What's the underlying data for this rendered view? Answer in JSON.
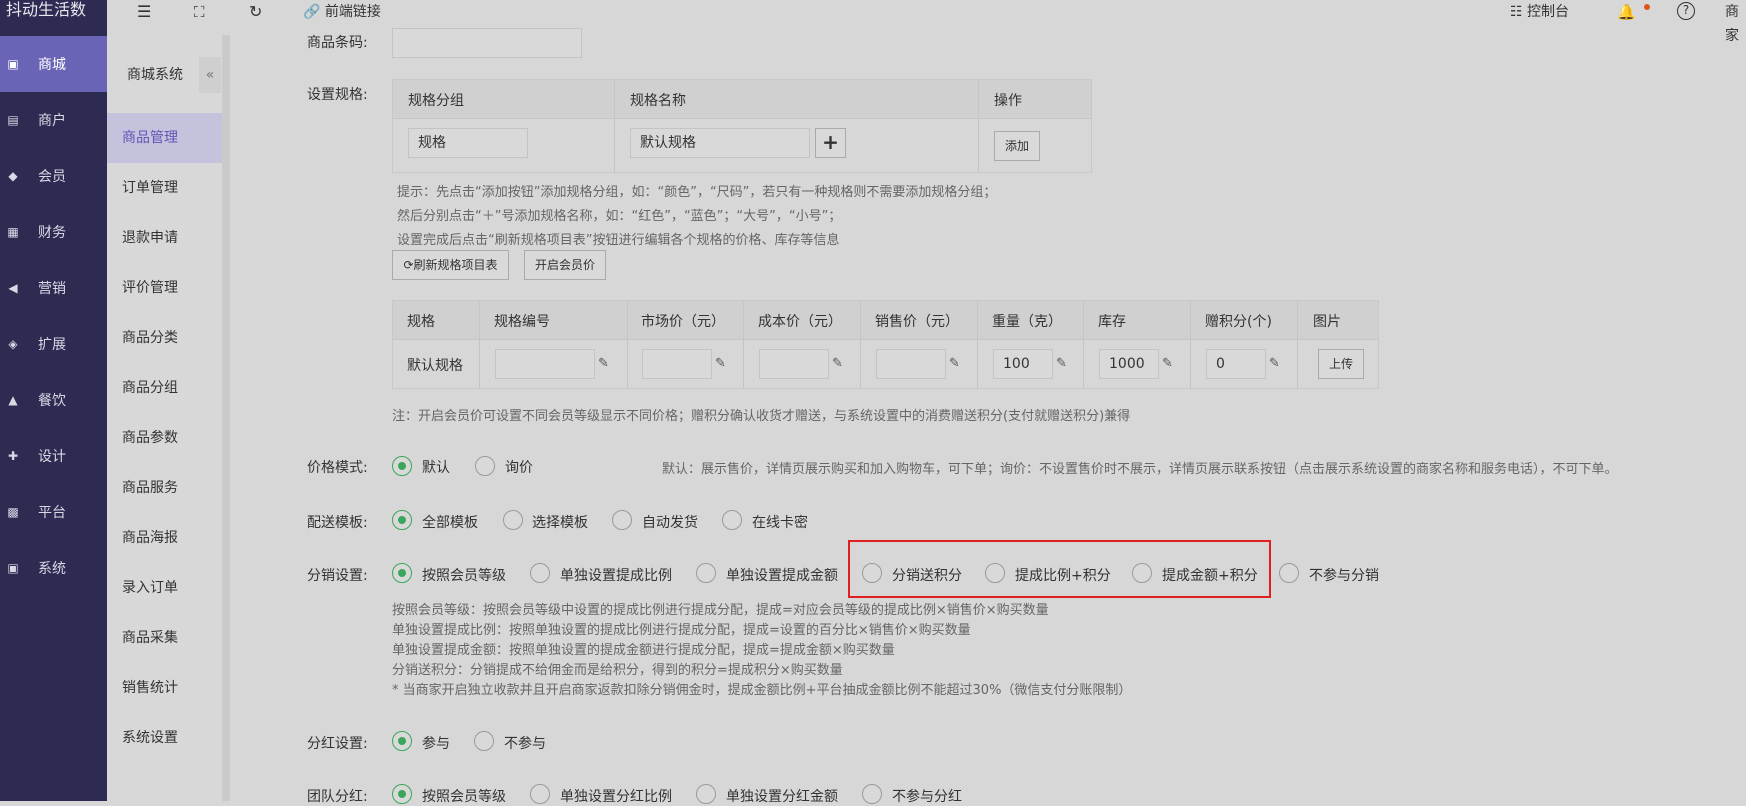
{
  "brand": "抖动生活数",
  "left_nav": [
    {
      "label": "商城",
      "icon": "shop-icon",
      "active": true
    },
    {
      "label": "商户",
      "icon": "merchant-icon",
      "active": false
    },
    {
      "label": "会员",
      "icon": "member-icon",
      "active": false
    },
    {
      "label": "财务",
      "icon": "finance-icon",
      "active": false
    },
    {
      "label": "营销",
      "icon": "marketing-icon",
      "active": false
    },
    {
      "label": "扩展",
      "icon": "extension-icon",
      "active": false
    },
    {
      "label": "餐饮",
      "icon": "dining-icon",
      "active": false
    },
    {
      "label": "设计",
      "icon": "design-icon",
      "active": false
    },
    {
      "label": "平台",
      "icon": "platform-icon",
      "active": false
    },
    {
      "label": "系统",
      "icon": "system-icon",
      "active": false
    }
  ],
  "sub_nav": {
    "title": "商城系统",
    "collapse_icon": "«",
    "items": [
      "商品管理",
      "订单管理",
      "退款申请",
      "评价管理",
      "商品分类",
      "商品分组",
      "商品参数",
      "商品服务",
      "商品海报",
      "录入订单",
      "商品采集",
      "销售统计",
      "系统设置"
    ]
  },
  "header": {
    "frontend_link": "前端链接",
    "console": "控制台",
    "merchant": "商家"
  },
  "form": {
    "barcode_label": "商品条码:",
    "spec_label": "设置规格:",
    "spec_table": {
      "headers": [
        "规格分组",
        "规格名称",
        "操作"
      ],
      "group_value": "规格",
      "name_value": "默认规格",
      "plus": "+",
      "add_button": "添加"
    },
    "spec_hints": [
      "提示：先点击“添加按钮”添加规格分组，如：“颜色”，“尺码”，若只有一种规格则不需要添加规格分组；",
      "然后分别点击“＋”号添加规格名称，如：“红色”，“蓝色”；“大号”，“小号”；",
      "设置完成后点击“刷新规格项目表”按钮进行编辑各个规格的价格、库存等信息"
    ],
    "refresh_button": "刷新规格项目表",
    "member_price_button": "开启会员价",
    "sku_table": {
      "headers": [
        "规格",
        "规格编号",
        "市场价（元）",
        "成本价（元）",
        "销售价（元）",
        "重量（克）",
        "库存",
        "赠积分(个)",
        "图片"
      ],
      "row": {
        "spec": "默认规格",
        "code": "",
        "market": "",
        "cost": "",
        "sale": "",
        "weight": "100",
        "stock": "1000",
        "points": "0",
        "upload": "上传"
      }
    },
    "sku_note": "注：开启会员价可设置不同会员等级显示不同价格；赠积分确认收货才赠送，与系统设置中的消费赠送积分(支付就赠送积分)兼得",
    "price_mode": {
      "label": "价格模式:",
      "options": [
        "默认",
        "询价"
      ],
      "selected": 0,
      "hint": "默认：展示售价，详情页展示购买和加入购物车，可下单；询价：不设置售价时不展示，详情页展示联系按钮（点击展示系统设置的商家名称和服务电话），不可下单。"
    },
    "delivery": {
      "label": "配送模板:",
      "options": [
        "全部模板",
        "选择模板",
        "自动发货",
        "在线卡密"
      ],
      "selected": 0
    },
    "distribution": {
      "label": "分销设置:",
      "options": [
        "按照会员等级",
        "单独设置提成比例",
        "单独设置提成金额",
        "分销送积分",
        "提成比例+积分",
        "提成金额+积分",
        "不参与分销"
      ],
      "selected": 0,
      "hints": [
        "按照会员等级：按照会员等级中设置的提成比例进行提成分配，提成=对应会员等级的提成比例×销售价×购买数量",
        "单独设置提成比例：按照单独设置的提成比例进行提成分配，提成=设置的百分比×销售价×购买数量",
        "单独设置提成金额：按照单独设置的提成金额进行提成分配，提成=提成金额×购买数量",
        "分销送积分：分销提成不给佣金而是给积分，得到的积分=提成积分×购买数量",
        "* 当商家开启独立收款并且开启商家返款扣除分销佣金时，提成金额比例+平台抽成金额比例不能超过30%（微信支付分账限制）"
      ]
    },
    "dividend": {
      "label": "分红设置:",
      "options": [
        "参与",
        "不参与"
      ],
      "selected": 0
    },
    "team_dividend": {
      "label": "团队分红:",
      "options": [
        "按照会员等级",
        "单独设置分红比例",
        "单独设置分红金额",
        "不参与分红"
      ],
      "selected": 0
    }
  },
  "colors": {
    "sidebar": "#2d2b52",
    "active_nav": "#6964b6",
    "radio_on": "#3aa65a",
    "highlight": "#e02020"
  }
}
